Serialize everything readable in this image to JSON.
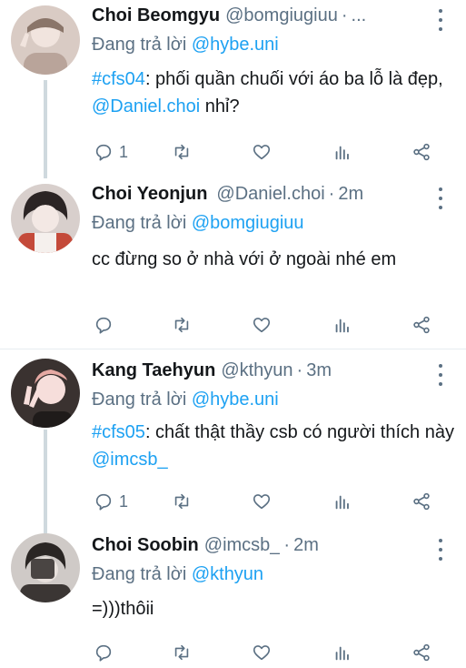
{
  "tweets": [
    {
      "name": "Choi Beomgyu",
      "handle": "@bomgiugiuu",
      "dot": "·",
      "time": "...",
      "reply_prefix": "Đang trả lời ",
      "reply_to": "@hybe.uni",
      "body_hashtag": "#cfs04",
      "body_text": ": phối quần chuối với áo ba lỗ là đẹp, ",
      "body_mention": "@Daniel.choi",
      "body_suffix": " nhỉ?",
      "reply_count": "1",
      "avatar_colors": [
        "#c9b8b0",
        "#e8dcd6",
        "#7a6a62"
      ]
    },
    {
      "name": "Choi Yeonjun",
      "handle": "@Daniel.choi",
      "dot": "·",
      "time": "2m",
      "reply_prefix": "Đang trả lời ",
      "reply_to": "@bomgiugiuu",
      "body_text": "cc đừng so ở nhà với ở ngoài nhé em",
      "reply_count": "",
      "avatar_colors": [
        "#2b2424",
        "#f0e6e2",
        "#c44a3a"
      ]
    },
    {
      "name": "Kang Taehyun",
      "handle": "@kthyun",
      "dot": "·",
      "time": "3m",
      "reply_prefix": "Đang trả lời ",
      "reply_to": "@hybe.uni",
      "body_hashtag": "#cfs05",
      "body_text": ": chất thật thầy csb có người thích này ",
      "body_mention": "@imcsb_",
      "reply_count": "1",
      "avatar_colors": [
        "#e6b6b2",
        "#f6dedb",
        "#3a2f2c"
      ]
    },
    {
      "name": "Choi Soobin",
      "handle": "@imcsb_",
      "dot": "·",
      "time": "2m",
      "reply_prefix": "Đang trả lời ",
      "reply_to": "@kthyun",
      "body_text": "=)))thôii",
      "reply_count": "",
      "avatar_colors": [
        "#5a5552",
        "#d6d2cf",
        "#2a2624"
      ]
    }
  ],
  "colors": {
    "accent": "#1da1f2",
    "muted": "#5b7083",
    "thread_line": "#cfd9de",
    "divider": "#e6ecf0"
  },
  "icons": [
    "reply-icon",
    "retweet-icon",
    "like-icon",
    "analytics-icon",
    "share-icon",
    "more-icon"
  ]
}
